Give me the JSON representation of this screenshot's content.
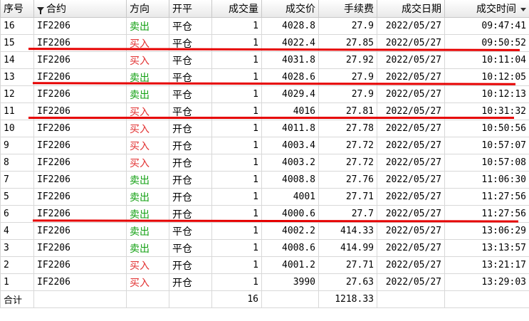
{
  "headers": {
    "seq": "序号",
    "contract": "合约",
    "direction": "方向",
    "open_close": "开平",
    "qty": "成交量",
    "price": "成交价",
    "fee": "手续费",
    "date": "成交日期",
    "time": "成交时间"
  },
  "rows": [
    {
      "seq": "16",
      "contract": "IF2206",
      "direction": "卖出",
      "open_close": "平仓",
      "qty": "1",
      "price": "4028.8",
      "fee": "27.9",
      "date": "2022/05/27",
      "time": "09:47:41"
    },
    {
      "seq": "15",
      "contract": "IF2206",
      "direction": "买入",
      "open_close": "平仓",
      "qty": "1",
      "price": "4022.4",
      "fee": "27.85",
      "date": "2022/05/27",
      "time": "09:50:52"
    },
    {
      "seq": "14",
      "contract": "IF2206",
      "direction": "买入",
      "open_close": "平仓",
      "qty": "1",
      "price": "4031.8",
      "fee": "27.92",
      "date": "2022/05/27",
      "time": "10:11:04"
    },
    {
      "seq": "13",
      "contract": "IF2206",
      "direction": "卖出",
      "open_close": "平仓",
      "qty": "1",
      "price": "4028.6",
      "fee": "27.9",
      "date": "2022/05/27",
      "time": "10:12:05"
    },
    {
      "seq": "12",
      "contract": "IF2206",
      "direction": "卖出",
      "open_close": "平仓",
      "qty": "1",
      "price": "4029.4",
      "fee": "27.9",
      "date": "2022/05/27",
      "time": "10:12:13"
    },
    {
      "seq": "11",
      "contract": "IF2206",
      "direction": "买入",
      "open_close": "平仓",
      "qty": "1",
      "price": "4016",
      "fee": "27.81",
      "date": "2022/05/27",
      "time": "10:31:32"
    },
    {
      "seq": "10",
      "contract": "IF2206",
      "direction": "买入",
      "open_close": "开仓",
      "qty": "1",
      "price": "4011.8",
      "fee": "27.78",
      "date": "2022/05/27",
      "time": "10:50:56"
    },
    {
      "seq": "9",
      "contract": "IF2206",
      "direction": "买入",
      "open_close": "开仓",
      "qty": "1",
      "price": "4003.4",
      "fee": "27.72",
      "date": "2022/05/27",
      "time": "10:57:07"
    },
    {
      "seq": "8",
      "contract": "IF2206",
      "direction": "买入",
      "open_close": "开仓",
      "qty": "1",
      "price": "4003.2",
      "fee": "27.72",
      "date": "2022/05/27",
      "time": "10:57:08"
    },
    {
      "seq": "7",
      "contract": "IF2206",
      "direction": "卖出",
      "open_close": "开仓",
      "qty": "1",
      "price": "4008.8",
      "fee": "27.76",
      "date": "2022/05/27",
      "time": "11:06:30"
    },
    {
      "seq": "5",
      "contract": "IF2206",
      "direction": "卖出",
      "open_close": "开仓",
      "qty": "1",
      "price": "4001",
      "fee": "27.71",
      "date": "2022/05/27",
      "time": "11:27:56"
    },
    {
      "seq": "6",
      "contract": "IF2206",
      "direction": "卖出",
      "open_close": "开仓",
      "qty": "1",
      "price": "4000.6",
      "fee": "27.7",
      "date": "2022/05/27",
      "time": "11:27:56"
    },
    {
      "seq": "4",
      "contract": "IF2206",
      "direction": "卖出",
      "open_close": "平仓",
      "qty": "1",
      "price": "4002.2",
      "fee": "414.33",
      "date": "2022/05/27",
      "time": "13:06:29"
    },
    {
      "seq": "3",
      "contract": "IF2206",
      "direction": "卖出",
      "open_close": "平仓",
      "qty": "1",
      "price": "4008.6",
      "fee": "414.99",
      "date": "2022/05/27",
      "time": "13:13:57"
    },
    {
      "seq": "2",
      "contract": "IF2206",
      "direction": "买入",
      "open_close": "开仓",
      "qty": "1",
      "price": "4001.2",
      "fee": "27.71",
      "date": "2022/05/27",
      "time": "13:21:17"
    },
    {
      "seq": "1",
      "contract": "IF2206",
      "direction": "买入",
      "open_close": "开仓",
      "qty": "1",
      "price": "3990",
      "fee": "27.63",
      "date": "2022/05/27",
      "time": "13:29:03"
    }
  ],
  "total": {
    "label": "合计",
    "qty": "16",
    "fee": "1218.33"
  },
  "colors": {
    "sell": "#12a012",
    "buy": "#e23232",
    "annotation_line": "#e60000"
  },
  "icons": {
    "contract_header": "filter-icon",
    "time_header": "sort-desc-icon"
  }
}
